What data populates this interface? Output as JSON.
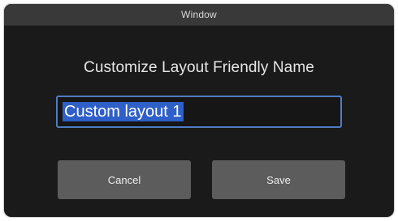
{
  "window": {
    "title": "Window"
  },
  "dialog": {
    "heading": "Customize Layout Friendly Name",
    "name_input": {
      "value": "Custom layout 1",
      "selected": true
    },
    "buttons": {
      "cancel_label": "Cancel",
      "save_label": "Save"
    }
  },
  "colors": {
    "window_background": "#1a1a1a",
    "titlebar_background": "#393939",
    "input_border_focus": "#4f7cc2",
    "selection_highlight": "#2f5fc8",
    "button_background": "#5c5c5c"
  }
}
